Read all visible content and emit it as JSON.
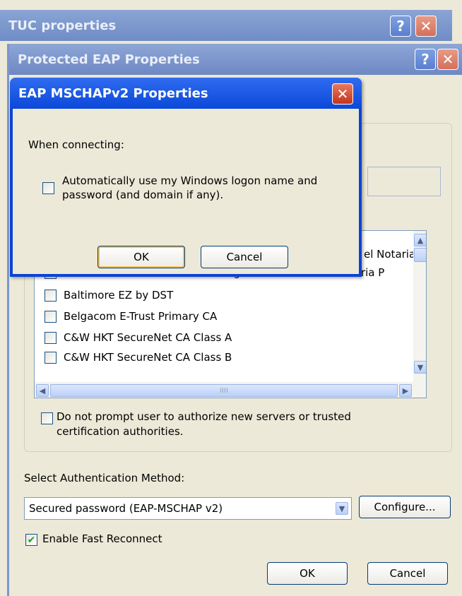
{
  "tuc_window": {
    "title": "TUC properties"
  },
  "peap_window": {
    "title": "Protected EAP Properties",
    "cert_list": [
      "el Notaria",
      "Autoridad Certificadora del Colegio Nacional de Correduria P",
      "Baltimore EZ by DST",
      "Belgacom E-Trust Primary CA",
      "C&W HKT SecureNet CA Class A",
      "C&W HKT SecureNet CA Class B"
    ],
    "hscroll_grip": "IIII",
    "no_prompt_label": "Do not prompt user to authorize new servers or trusted certification authorities.",
    "auth_method_label": "Select Authentication Method:",
    "auth_method_value": "Secured password (EAP-MSCHAP v2)",
    "configure_label": "Configure...",
    "fast_reconnect_label": "Enable Fast Reconnect",
    "fast_reconnect_checked": true,
    "ok_label": "OK",
    "cancel_label": "Cancel"
  },
  "mschap_dialog": {
    "title": "EAP MSCHAPv2 Properties",
    "when_connecting": "When connecting:",
    "auto_logon_label": "Automatically use my Windows logon name and password (and domain if any).",
    "auto_logon_checked": false,
    "ok_label": "OK",
    "cancel_label": "Cancel"
  },
  "icons": {
    "help": "help-icon",
    "close": "close-icon",
    "check": "check-icon"
  }
}
